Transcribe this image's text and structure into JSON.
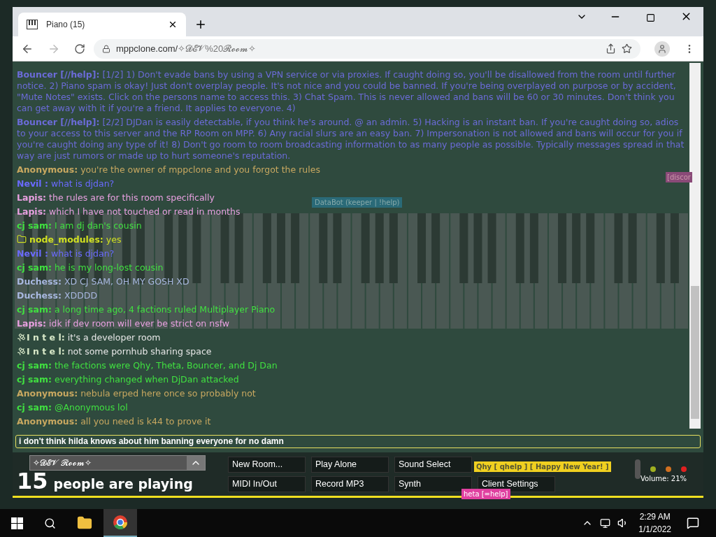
{
  "browser": {
    "tab_title": "Piano (15)",
    "url_host": "mppclone.com/",
    "url_path": "✧𝓓𝓔𝓥%20𝓡𝓸𝓸𝓶✧"
  },
  "chat": {
    "messages": [
      {
        "kind": "plain",
        "name": "Bouncer [//help]:",
        "color": "#6b6bd8",
        "text": "[1/2] 1) Don't evade bans by using a VPN service or via proxies. If caught doing so, you'll be disallowed from the room until further notice. 2) Piano spam is okay! Just don't overplay people. It's not nice and you could be banned. If you're being overplayed on purpose or by accident, \"Mute Notes\" exists. Click on the persons name to access this. 3) Chat Spam. This is never allowed and bans will be 60 or 30 minutes. Don't think you can get away with it if you're a friend. It applies to everyone. 4)"
      },
      {
        "kind": "plain",
        "name": "Bouncer [//help]:",
        "color": "#6b6bd8",
        "text": "[2/2] DJDan is easily detectable, if you think he's around. @ an admin. 5) Hacking is an instant ban. If you're caught doing so, adios to your access to this server and the RP Room on MPP. 6) Any racial slurs are an easy ban. 7) Impersonation is not allowed and bans will occur for you if you're caught doing any type of it! 8) Don't go room to room broadcasting information to as many people as possible. Typically messages spread in that way are just rumors or made up to hurt someone's reputation."
      },
      {
        "kind": "plain",
        "name": "Anonymous:",
        "color": "#c8a860",
        "text": "you're the owner of mppclone and you forgot the rules"
      },
      {
        "kind": "plain",
        "name": "Nevil :",
        "color": "#6a6aff",
        "text": "what is djdan?"
      },
      {
        "kind": "plain",
        "name": "Lapis:",
        "color": "#e8a0e0",
        "text": "the rules are for this room specifically"
      },
      {
        "kind": "plain",
        "name": "Lapis:",
        "color": "#e8a0e0",
        "text": "which I have not touched or read in months"
      },
      {
        "kind": "plain",
        "name": "cj sam:",
        "color": "#40e040",
        "text": "I am dj dan's cousin"
      },
      {
        "kind": "folder",
        "name": "node_modules:",
        "color": "#d0e020",
        "text": "yes"
      },
      {
        "kind": "plain",
        "name": "Nevil :",
        "color": "#6a6aff",
        "text": "what is djdan?"
      },
      {
        "kind": "plain",
        "name": "cj sam:",
        "color": "#40e040",
        "text": "he is my long-lost cousin"
      },
      {
        "kind": "plain",
        "name": "Duchess:",
        "color": "#a8b8e0",
        "text": "XD CJ SAM, OH MY GOSH XD"
      },
      {
        "kind": "plain",
        "name": "Duchess:",
        "color": "#a8b8e0",
        "text": "XDDDD"
      },
      {
        "kind": "plain",
        "name": "cj sam:",
        "color": "#40e040",
        "text": "a long time ago, 4 factions ruled Multiplayer Piano"
      },
      {
        "kind": "plain",
        "name": "Lapis:",
        "color": "#e8a0e0",
        "text": "idk if dev room will ever be strict on nsfw"
      },
      {
        "kind": "satellite",
        "name": "I n t e l:",
        "color": "#d8e8c8",
        "text": "it's a developer room"
      },
      {
        "kind": "satellite",
        "name": "I n t e l:",
        "color": "#d8e8c8",
        "text": "not some pornhub sharing space"
      },
      {
        "kind": "plain",
        "name": "cj sam:",
        "color": "#40e040",
        "text": "the factions were Qhy, Theta, Bouncer, and Dj Dan"
      },
      {
        "kind": "plain",
        "name": "cj sam:",
        "color": "#40e040",
        "text": "everything changed when DjDan attacked"
      },
      {
        "kind": "plain",
        "name": "Anonymous:",
        "color": "#c8a860",
        "text": "nebula erped here once so probably not"
      },
      {
        "kind": "plain",
        "name": "cj sam:",
        "color": "#40e040",
        "text": "@Anonymous lol"
      },
      {
        "kind": "plain",
        "name": "Anonymous:",
        "color": "#c8a860",
        "text": "all you need is k44 to prove it"
      }
    ],
    "input_value": "i don't think hilda knows about him banning everyone for no damn"
  },
  "cursor_tags": [
    {
      "text": "DataBot (keeper | !help)",
      "color": "#2a6a78"
    },
    {
      "text": "[discor",
      "color": "#8a4a78"
    },
    {
      "text": "Qhy [ qhelp ] [ Happy New Year! ]",
      "color": "#f0d020"
    },
    {
      "text": "heta [=help]",
      "color": "#e040a0"
    }
  ],
  "controls": {
    "room": "✧𝓓𝓔𝓥 𝓡𝓸𝓸𝓶✧",
    "player_count": "15",
    "player_label": "people are playing",
    "buttons": [
      "New Room...",
      "Play Alone",
      "Sound Select",
      "MIDI In/Out",
      "Record MP3",
      "Synth",
      "Client Settings"
    ],
    "status_lights": [
      {
        "color": "#a0b020"
      },
      {
        "color": "#d07020"
      },
      {
        "color": "#e02020"
      }
    ],
    "volume": "Volume: 21%"
  },
  "taskbar": {
    "time": "2:29 AM",
    "date": "1/1/2022"
  }
}
